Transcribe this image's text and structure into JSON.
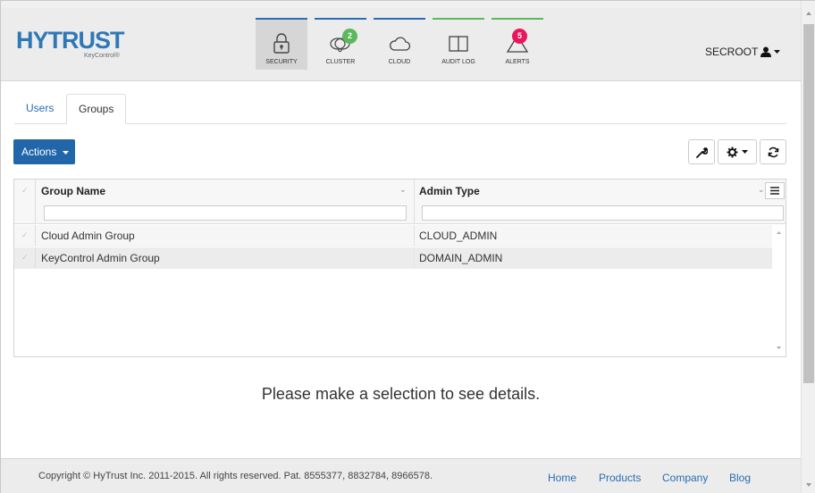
{
  "brand": {
    "name": "HYTRUST",
    "product": "KeyControl®"
  },
  "nav": [
    {
      "label": "SECURITY",
      "icon": "lock-icon",
      "active": true,
      "badge": null
    },
    {
      "label": "CLUSTER",
      "icon": "cluster-icon",
      "active": false,
      "badge": "2"
    },
    {
      "label": "CLOUD",
      "icon": "cloud-icon",
      "active": false,
      "badge": null
    },
    {
      "label": "AUDIT LOG",
      "icon": "book-icon",
      "active": false,
      "badge": null
    },
    {
      "label": "ALERTS",
      "icon": "warning-icon",
      "active": false,
      "badge": "5"
    }
  ],
  "user": {
    "name": "SECROOT"
  },
  "tabs": [
    {
      "label": "Users",
      "active": false
    },
    {
      "label": "Groups",
      "active": true
    }
  ],
  "toolbar": {
    "actions_label": "Actions"
  },
  "table": {
    "columns": [
      "Group Name",
      "Admin Type"
    ],
    "rows": [
      {
        "group_name": "Cloud Admin Group",
        "admin_type": "CLOUD_ADMIN"
      },
      {
        "group_name": "KeyControl Admin Group",
        "admin_type": "DOMAIN_ADMIN"
      }
    ],
    "filters": {
      "group_name": "",
      "admin_type": ""
    }
  },
  "details": {
    "empty_message": "Please make a selection to see details."
  },
  "footer": {
    "copyright": "Copyright © HyTrust Inc. 2011-2015. All rights reserved. Pat. 8555377, 8832784, 8966578.",
    "links": [
      "Home",
      "Products",
      "Company",
      "Blog"
    ]
  },
  "colors": {
    "primary": "#2266aa",
    "link": "#2a6db3",
    "nav_blue": "#2a6db3",
    "nav_green": "#5cb85c",
    "badge_green": "#5cb85c",
    "badge_red": "#e8175d"
  }
}
